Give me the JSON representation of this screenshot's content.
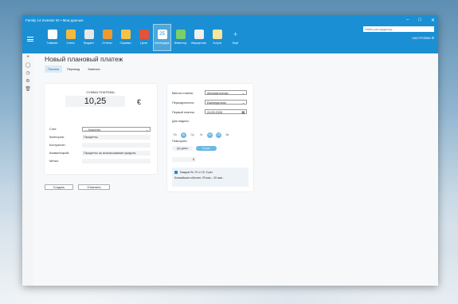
{
  "window": {
    "title": "Family 14 Investor ID • Мои данные"
  },
  "search": {
    "placeholder": "Найти расход/доход..."
  },
  "settings_label": "НАСТРОЙКИ",
  "nav": [
    {
      "label": "Главная",
      "color": "#ffffff"
    },
    {
      "label": "Счета",
      "color": "#f5b93d"
    },
    {
      "label": "Бюджет",
      "color": "#e8e8e8"
    },
    {
      "label": "Отчеты",
      "color": "#f09a2e"
    },
    {
      "label": "Справки",
      "color": "#f4c247"
    },
    {
      "label": "Цели",
      "color": "#e4523b"
    },
    {
      "label": "Календарь",
      "color": "#ffffff"
    },
    {
      "label": "Инвестор",
      "color": "#7ccf67"
    },
    {
      "label": "Имущество",
      "color": "#f0f0f0"
    },
    {
      "label": "Услуги",
      "color": "#f6e59a"
    },
    {
      "label": "Ещё",
      "color": "#cfe6f6"
    }
  ],
  "calendar_day": "25",
  "page": {
    "title": "Новый плановый платеж"
  },
  "tabs": [
    "Платеж",
    "Перевод",
    "Заметка"
  ],
  "form": {
    "amount_label": "СУММА ПЛАТЕЖА:",
    "amount": "10,25",
    "currency": "€",
    "account_label": "Счет:",
    "account_value": "— Кошелек",
    "category_label": "Категория:",
    "category_value": "Проценты",
    "counterparty_label": "Контрагент:",
    "comment_label": "Комментарий:",
    "comment_value": "Проценты за использование кредита",
    "tags_label": "Метки:",
    "create_button": "Создать",
    "cancel_button": "Отменить"
  },
  "schedule": {
    "mode_label": "Ввести платеж:",
    "mode_value": "Автоматически",
    "period_label": "Периодичность:",
    "period_value": "Еженедельно",
    "first_label": "Первый платеж:",
    "first_value": "24.05.2026",
    "days_label": "Дни недели:",
    "days": [
      {
        "label": "Пн",
        "on": false
      },
      {
        "label": "Вт",
        "on": true
      },
      {
        "label": "Ср",
        "on": false
      },
      {
        "label": "Чт",
        "on": false
      },
      {
        "label": "Пт",
        "on": true
      },
      {
        "label": "Сб",
        "on": true
      },
      {
        "label": "Вс",
        "on": false
      }
    ],
    "repeat_label": "Повторять:",
    "repeat_until": "До даты",
    "repeat_count": "N раз",
    "repeat_times": "5",
    "summary_line1": "Каждые Вт, Пт и Сб, 5 раз",
    "summary_line2": "Ближайшие события: 29 мая – 30 мая..."
  }
}
